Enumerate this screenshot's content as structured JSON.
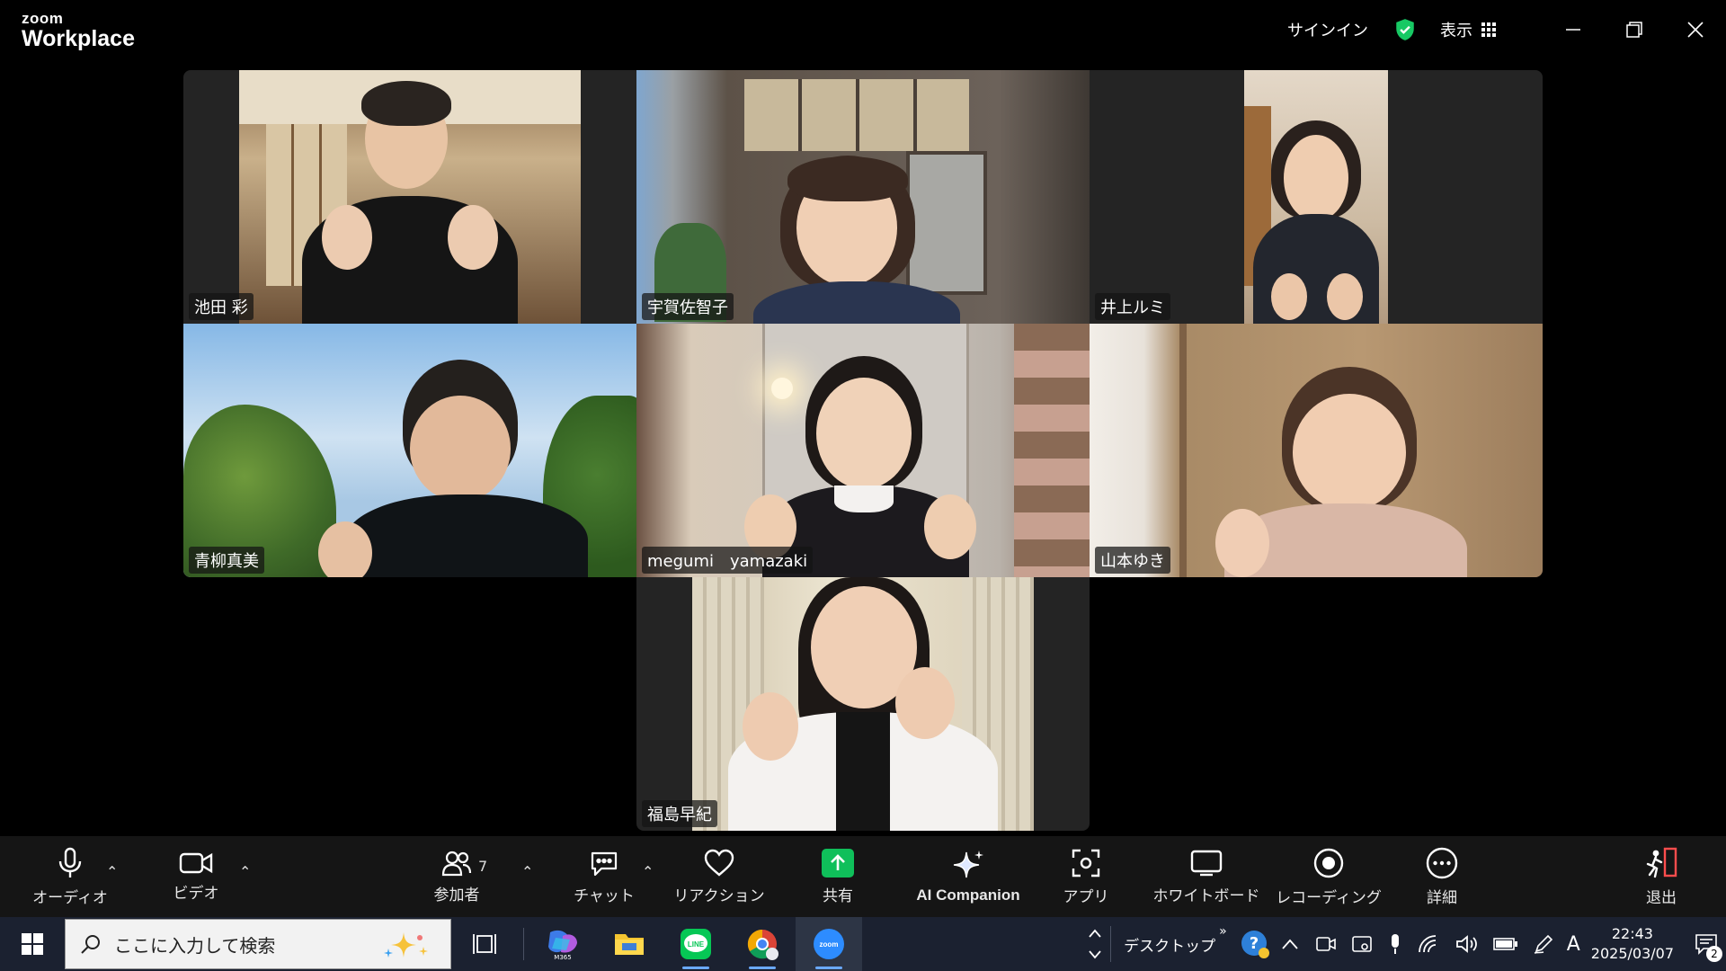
{
  "app": {
    "logo_small": "zoom",
    "logo_large": "Workplace"
  },
  "titlebar": {
    "signin": "サインイン",
    "view": "表示"
  },
  "participants": [
    {
      "name": "池田 彩",
      "active": false
    },
    {
      "name": "宇賀佐智子",
      "active": true
    },
    {
      "name": "井上ルミ",
      "active": false
    },
    {
      "name": "青柳真美",
      "active": false
    },
    {
      "name": "megumi　yamazaki",
      "active": false
    },
    {
      "name": "山本ゆき",
      "active": false
    },
    {
      "name": "福島早紀",
      "active": false
    }
  ],
  "controls": {
    "audio": "オーディオ",
    "video": "ビデオ",
    "participants": "参加者",
    "participants_count": "7",
    "chat": "チャット",
    "reactions": "リアクション",
    "share": "共有",
    "ai_companion": "AI Companion",
    "apps": "アプリ",
    "whiteboard": "ホワイトボード",
    "recording": "レコーディング",
    "more": "詳細",
    "leave": "退出"
  },
  "taskbar": {
    "search_placeholder": "ここに入力して検索",
    "desktop": "デスクトップ",
    "time": "22:43",
    "date": "2025/03/07",
    "notification_count": "2",
    "ime": "A",
    "apps": [
      "task-view",
      "m365",
      "file-explorer",
      "line",
      "chrome",
      "zoom"
    ]
  },
  "colors": {
    "active_speaker": "#2ecc71",
    "share": "#0fbf5a",
    "shield": "#17c964"
  }
}
